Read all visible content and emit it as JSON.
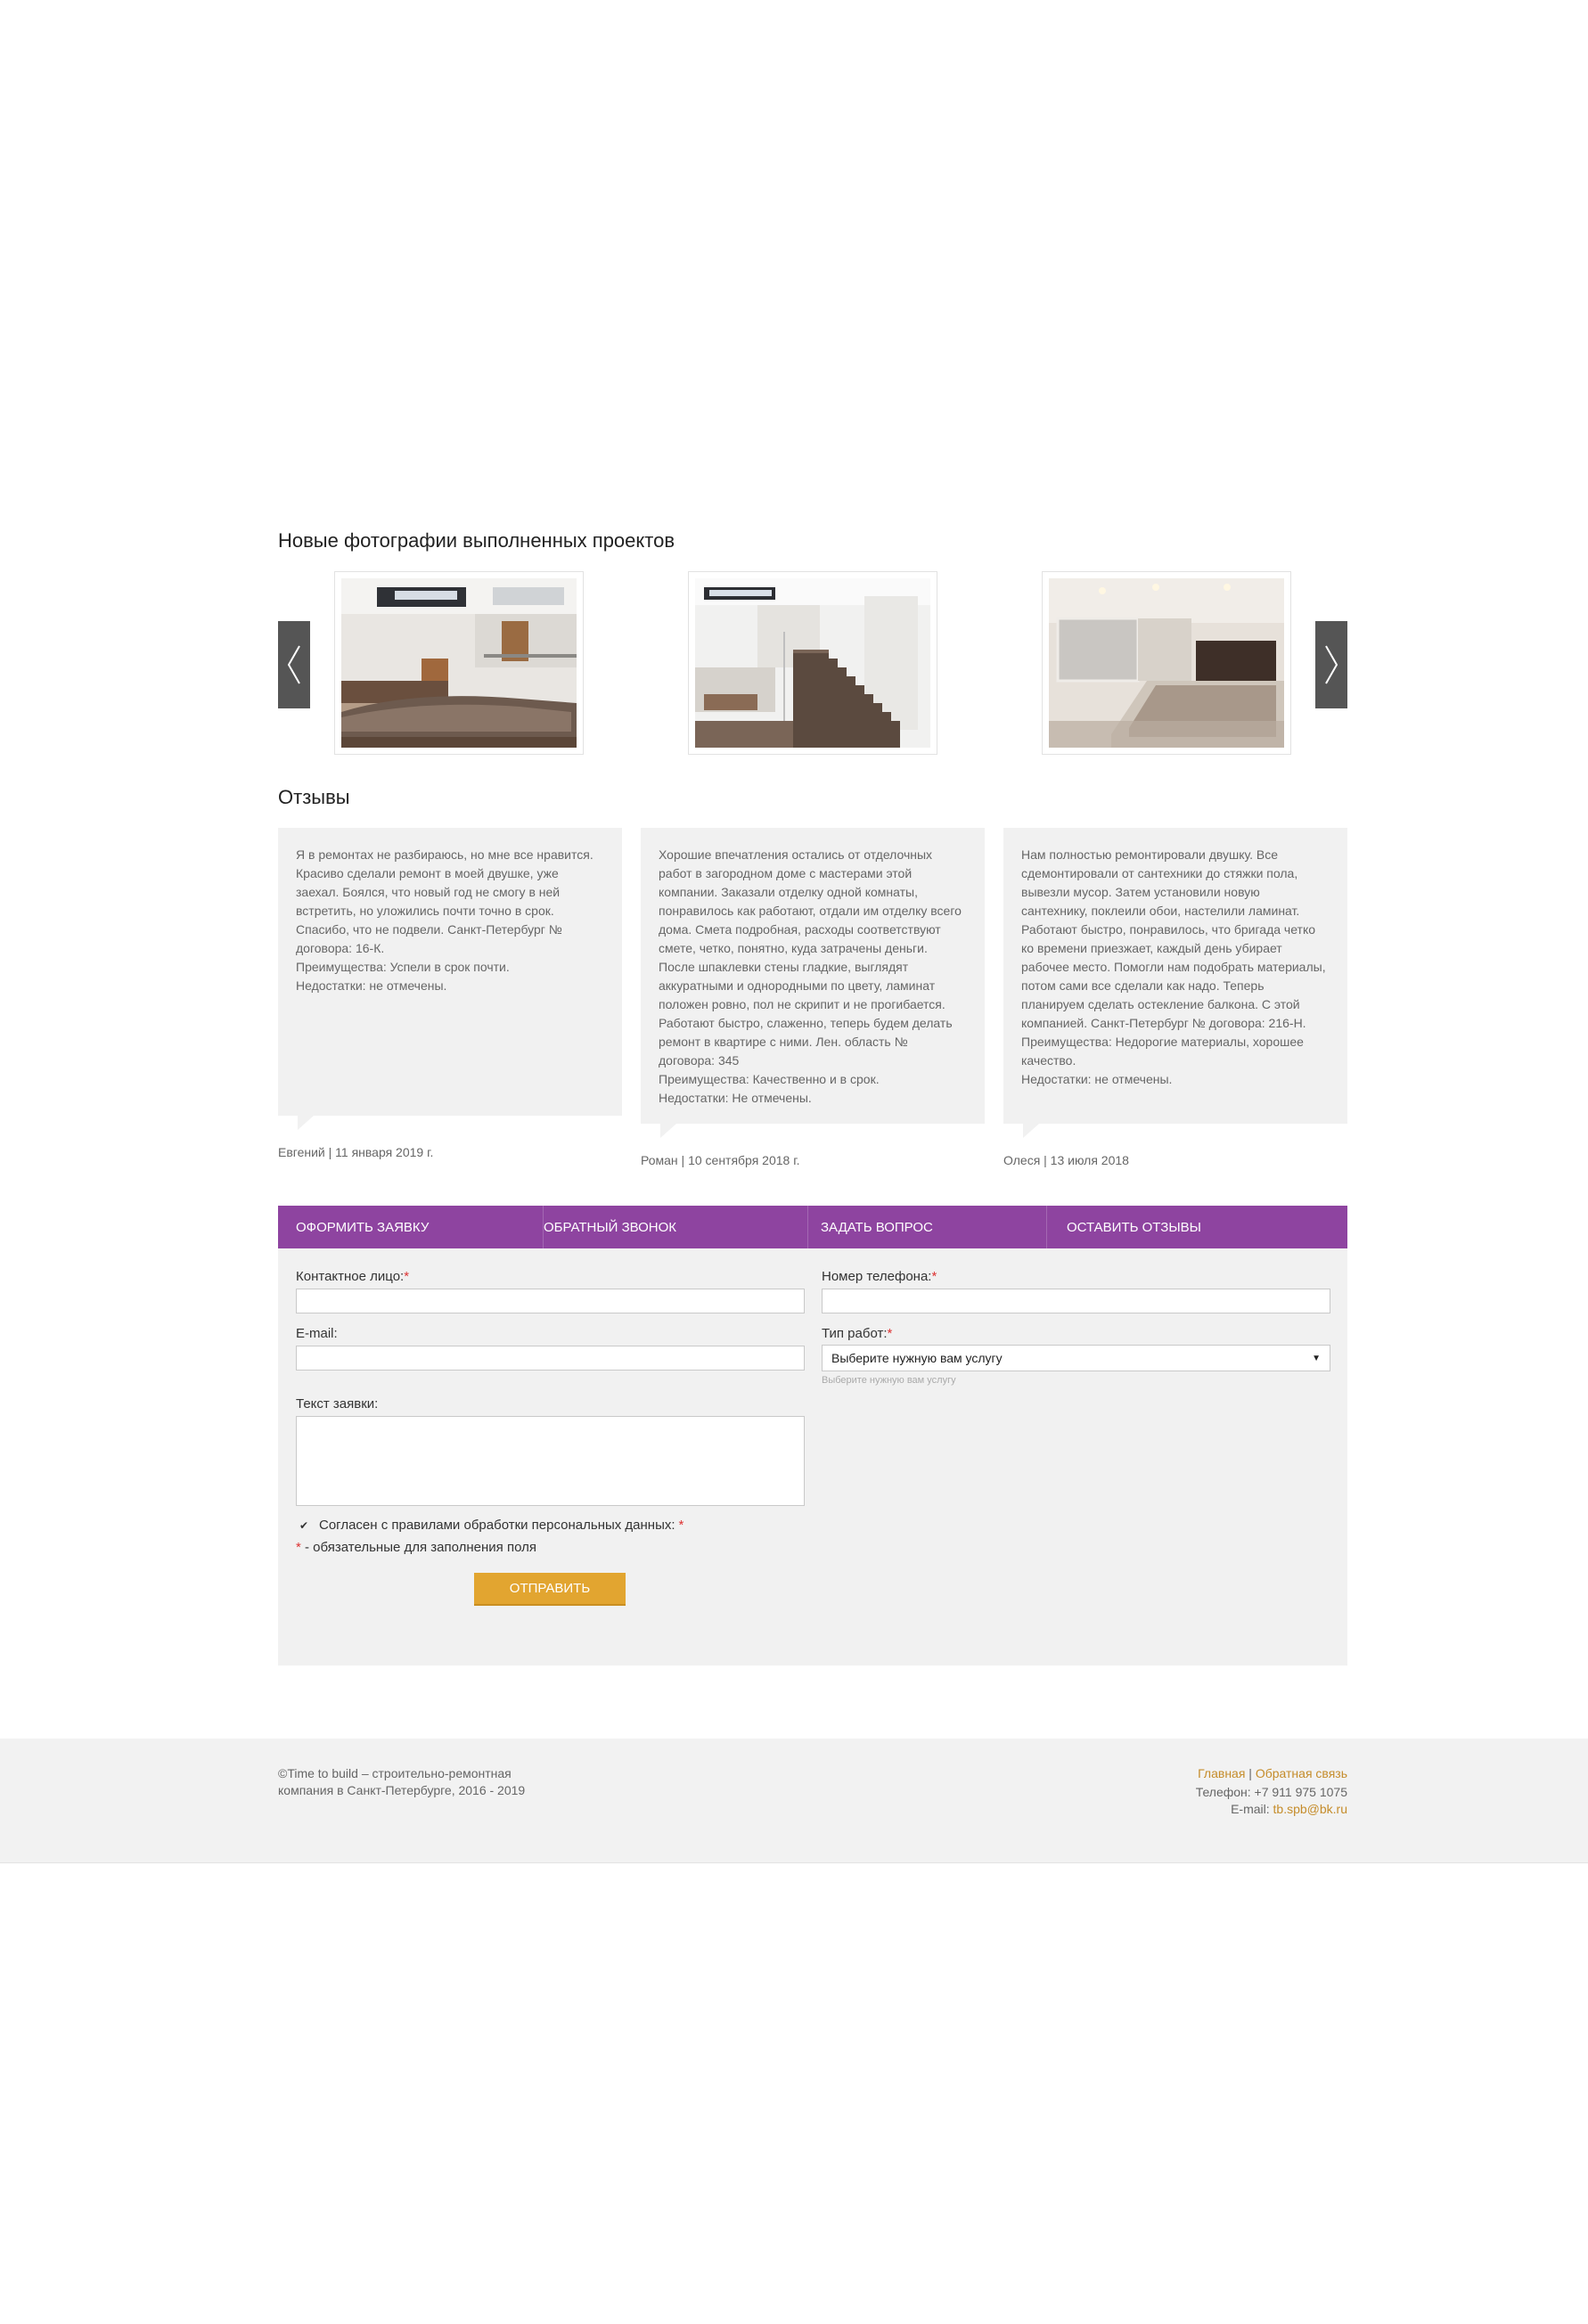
{
  "gallery": {
    "title": "Новые фотографии выполненных проектов",
    "photos": [
      {
        "name": "living-room-photo"
      },
      {
        "name": "staircase-photo"
      },
      {
        "name": "bedroom-photo"
      }
    ]
  },
  "reviews": {
    "title": "Отзывы",
    "items": [
      {
        "text": "Я в ремонтах не разбираюсь, но мне все нравится. Красиво сделали ремонт в моей двушке, уже заехал. Боялся, что новый год не смогу в ней встретить, но уложились почти точно в срок. Спасибо, что не подвели. Санкт-Петербург № договора: 16-К.\nПреимущества: Успели в срок почти.\nНедостатки: не отмечены.",
        "meta": "Евгений | 11 января 2019 г."
      },
      {
        "text": "Хорошие впечатления остались от отделочных работ в загородном доме с мастерами этой компании. Заказали отделку одной комнаты, понравилось как работают, отдали им отделку всего дома. Смета подробная, расходы соответствуют смете, четко, понятно, куда затрачены деньги. После шпаклевки стены гладкие, выглядят аккуратными и однородными по цвету, ламинат положен ровно, пол не скрипит и не прогибается. Работают быстро, слаженно, теперь будем делать ремонт в квартире с ними. Лен. область № договора: 345\nПреимущества: Качественно и в срок.\nНедостатки: Не отмечены.",
        "meta": "Роман | 10 сентября 2018 г."
      },
      {
        "text": "Нам полностью ремонтировали двушку. Все сдемонтировали от сантехники до стяжки пола, вывезли мусор. Затем установили новую сантехнику, поклеили обои, настелили ламинат. Работают быстро, понравилось, что бригада четко ко времени приезжает, каждый день убирает рабочее место. Помогли нам подобрать материалы, потом сами все сделали как надо. Теперь планируем сделать остекление балкона. С этой компанией. Санкт-Петербург № договора: 216-Н.\nПреимущества: Недорогие материалы, хорошее качество.\nНедостатки: не отмечены.",
        "meta": "Олеся | 13 июля 2018"
      }
    ]
  },
  "form": {
    "tabs": [
      "Оформить заявку",
      "Обратный звонок",
      "Задать вопрос",
      "Оставить отзывы"
    ],
    "contact_label": "Контактное лицо:",
    "phone_label": "Номер телефона:",
    "email_label": "E-mail:",
    "work_type_label": "Тип работ:",
    "work_type_value": "Выберите нужную вам услугу",
    "work_type_hint": "Выберите нужную вам услугу",
    "message_label": "Текст заявки:",
    "required_mark": "*",
    "consent_label": "Согласен с правилами обработки персональных данных:",
    "consent_checked": true,
    "required_note": " - обязательные для заполнения поля",
    "submit_label": "Отправить"
  },
  "footer": {
    "copyright_line1": "©Time to build – строительно-ремонтная",
    "copyright_line2": "компания в Санкт-Петербурге, 2016 - 2019",
    "link_home": "Главная",
    "link_sep": " | ",
    "link_feedback": "Обратная связь",
    "phone": "Телефон: +7 911 975 1075",
    "email_label": "E-mail: ",
    "email": "tb.spb@bk.ru"
  },
  "colors": {
    "tab_bar": "#8e44a0",
    "submit": "#e2a530",
    "link": "#c58c2a",
    "required": "#dd3333"
  }
}
